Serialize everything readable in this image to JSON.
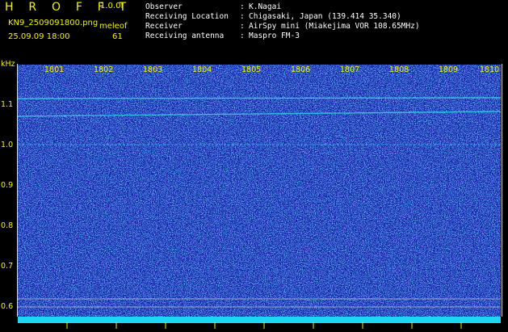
{
  "header": {
    "app_name": "H R O F F T",
    "version": "1.0.0f",
    "filename": "KN9_2509091800.png",
    "meleo_label": "meleof",
    "datetime": "25.09.09 18:00",
    "meleo_value": "61",
    "info": [
      {
        "key": "Observer",
        "value": "K.Nagai"
      },
      {
        "key": "Receiving Location",
        "value": "Chigasaki, Japan (139.414 35.340)"
      },
      {
        "key": "Receiver",
        "value": "AirSpy mini (Miakejima VOR 108.65MHz)"
      },
      {
        "key": "Receiving antenna",
        "value": "Maspro FM-3"
      }
    ]
  },
  "spectrogram": {
    "y_unit": "kHz",
    "y_ticks": [
      "1.1",
      "1.0",
      "0.9",
      "0.8",
      "0.7",
      "0.6"
    ],
    "time_ticks": [
      "1801",
      "1802",
      "1803",
      "1804",
      "1805",
      "1806",
      "1807",
      "1808",
      "1809",
      "1810"
    ],
    "colors": {
      "background": "#13199a",
      "noise_bright": "#2bd0f0",
      "axis_text": "#f4f400",
      "bottom_band": "#1bd7f4"
    }
  }
}
